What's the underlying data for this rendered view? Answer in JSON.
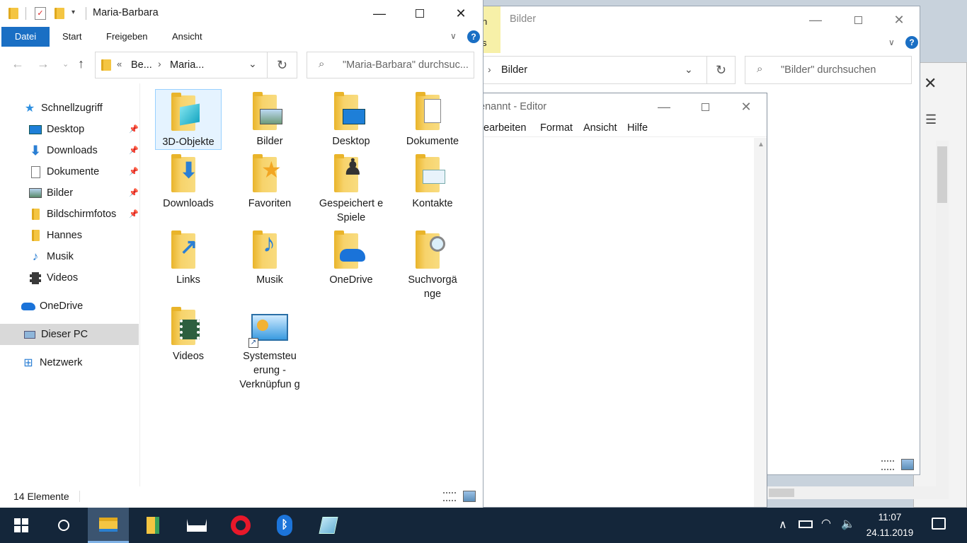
{
  "explorer": {
    "title": "Maria-Barbara",
    "ribbon_tabs": [
      "Datei",
      "Start",
      "Freigeben",
      "Ansicht"
    ],
    "breadcrumb": [
      "Be...",
      "Maria..."
    ],
    "breadcrumb_chevron": "«",
    "search_placeholder": "\"Maria-Barbara\" durchsuc...",
    "status": "14 Elemente",
    "nav": {
      "quick_access": "Schnellzugriff",
      "items": [
        "Desktop",
        "Downloads",
        "Dokumente",
        "Bilder",
        "Bildschirmfotos",
        "Hannes",
        "Musik",
        "Videos"
      ],
      "onedrive": "OneDrive",
      "this_pc": "Dieser PC",
      "network": "Netzwerk"
    },
    "tiles": [
      "3D-Objekte",
      "Bilder",
      "Desktop",
      "Dokumente",
      "Downloads",
      "Favoriten",
      "Gespeichert e Spiele",
      "Kontakte",
      "Links",
      "Musik",
      "OneDrive",
      "Suchvorgä nge",
      "Videos",
      "Systemsteu erung - Verknüpfun g"
    ]
  },
  "bilder_window": {
    "title": "Bilder",
    "tab_partial_top": "n",
    "tab_partial_bottom": "s",
    "address": "Bilder",
    "search_placeholder": "\"Bilder\" durchsuchen"
  },
  "editor_window": {
    "title": "enannt - Editor",
    "menu": [
      "Bearbeiten",
      "Format",
      "Ansicht",
      "Hilfe"
    ],
    "menu_first_visible": "earbeiten"
  },
  "taskbar": {
    "time": "11:07",
    "date": "24.11.2019"
  },
  "colors": {
    "accent": "#1a6fc4",
    "taskbar": "#14263a",
    "selection": "#cce8ff",
    "folder": "#f4c542"
  }
}
